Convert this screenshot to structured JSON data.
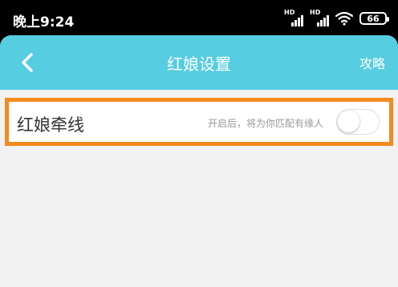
{
  "status_bar": {
    "time": "晚上9:24",
    "signal1_label": "HD",
    "signal2_label": "HD",
    "battery": "66",
    "icons": [
      "signal-icon",
      "signal-icon",
      "wifi-icon",
      "battery-icon"
    ]
  },
  "navbar": {
    "title": "红娘设置",
    "right_action": "攻略",
    "back_icon": "chevron-left-icon",
    "color": "#56cde0"
  },
  "setting": {
    "label": "红娘牵线",
    "hint": "开启后，将为你匹配有缘人",
    "toggle_on": false,
    "highlight_color": "#f58a1f"
  }
}
